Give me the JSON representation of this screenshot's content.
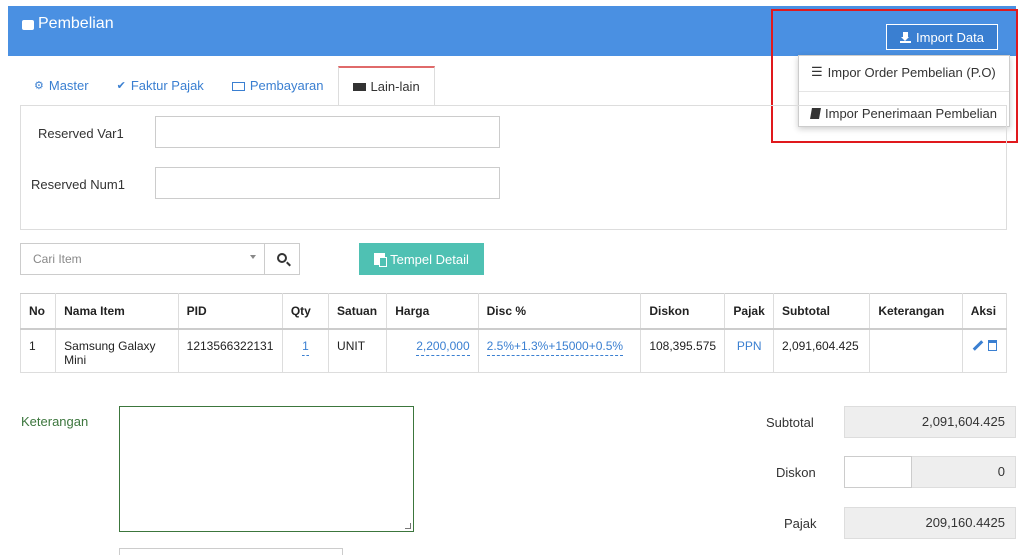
{
  "header": {
    "title": "Pembelian",
    "import_button": "Import Data"
  },
  "import_menu": {
    "items": [
      {
        "label": "Impor Order Pembelian (P.O)",
        "icon": "list-icon"
      },
      {
        "label": "Impor Penerimaan Pembelian",
        "icon": "book-icon"
      }
    ]
  },
  "tabs": [
    {
      "label": "Master",
      "icon": "cogs-icon",
      "active": false
    },
    {
      "label": "Faktur Pajak",
      "icon": "check-circle-icon",
      "active": false
    },
    {
      "label": "Pembayaran",
      "icon": "money-icon",
      "active": false
    },
    {
      "label": "Lain-lain",
      "icon": "truck-icon",
      "active": true
    }
  ],
  "fields": {
    "reserved_var1": {
      "label": "Reserved Var1",
      "value": ""
    },
    "reserved_num1": {
      "label": "Reserved Num1",
      "value": ""
    }
  },
  "search": {
    "placeholder": "Cari Item"
  },
  "paste_button": "Tempel Detail",
  "table": {
    "columns": [
      "No",
      "Nama Item",
      "PID",
      "Qty",
      "Satuan",
      "Harga",
      "Disc %",
      "Diskon",
      "Pajak",
      "Subtotal",
      "Keterangan",
      "Aksi"
    ],
    "rows": [
      {
        "no": "1",
        "nama_item": "Samsung Galaxy Mini",
        "pid": "1213566322131",
        "qty": "1",
        "satuan": "UNIT",
        "harga": "2,200,000",
        "disc": "2.5%+1.3%+15000+0.5%",
        "diskon": "108,395.575",
        "pajak": "PPN",
        "subtotal": "2,091,604.425",
        "keterangan": ""
      }
    ]
  },
  "notes": {
    "label": "Keterangan",
    "value": ""
  },
  "summary": {
    "subtotal_label": "Subtotal",
    "subtotal_value": "2,091,604.425",
    "diskon_label": "Diskon",
    "diskon_value": "0",
    "pajak_label": "Pajak",
    "pajak_value": "209,160.4425"
  },
  "colors": {
    "header_bg": "#4a90e2",
    "accent": "#3a7fd1",
    "paste_btn": "#4fc1b3",
    "highlight": "#e0191d"
  }
}
